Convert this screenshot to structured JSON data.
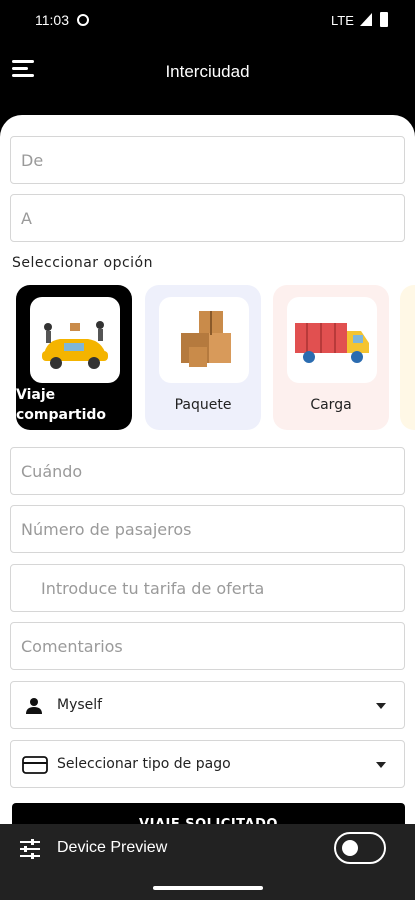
{
  "status": {
    "time": "11:03",
    "network": "LTE"
  },
  "appbar": {
    "title": "Interciudad"
  },
  "form": {
    "from_placeholder": "De",
    "to_placeholder": "A",
    "section_label": "Seleccionar opción",
    "options": [
      {
        "label": "Viaje compartido",
        "icon": "shared-car-icon",
        "selected": true
      },
      {
        "label": "Paquete",
        "icon": "package-icon",
        "selected": false
      },
      {
        "label": "Carga",
        "icon": "truck-icon",
        "selected": false
      }
    ],
    "when_placeholder": "Cuándo",
    "passengers_placeholder": "Número de pasajeros",
    "fare_placeholder": "Introduce tu tarifa de oferta",
    "comments_placeholder": "Comentarios",
    "passenger_select": "Myself",
    "payment_select": "Seleccionar tipo de pago",
    "submit_label": "VIAJE SOLICITADO"
  },
  "device_preview": {
    "label": "Device Preview",
    "enabled": false
  },
  "colors": {
    "black": "#000000",
    "option_package_bg": "#eef0fb",
    "option_cargo_bg": "#fdf0ee"
  }
}
